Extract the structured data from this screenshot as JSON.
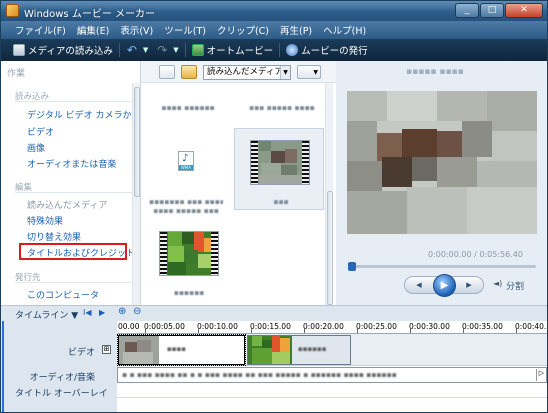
{
  "window": {
    "title": "Windows ムービー メーカー",
    "controls": [
      "_",
      "□",
      "✕"
    ]
  },
  "menu": [
    "ファイル(F)",
    "編集(E)",
    "表示(V)",
    "ツール(T)",
    "クリップ(C)",
    "再生(P)",
    "ヘルプ(H)"
  ],
  "toolbar": {
    "import_label": "メディアの読み込み",
    "undo_icon": "undo-icon",
    "redo_icon": "redo-icon",
    "automovie_label": "オートムービー",
    "publish_label": "ムービーの発行"
  },
  "tasks": {
    "pane_title": "作業",
    "import_header": "読み込み",
    "import_links": [
      "デジタル ビデオ カメラから",
      "ビデオ",
      "画像",
      "オーディオまたは音楽"
    ],
    "edit_header": "編集",
    "edit_links": [
      {
        "label": "読み込んだメディア",
        "enabled": false
      },
      {
        "label": "特殊効果",
        "enabled": true
      },
      {
        "label": "切り替え効果",
        "enabled": true
      },
      {
        "label": "タイトルおよびクレジット",
        "enabled": true,
        "highlighted": true
      }
    ],
    "publish_header": "発行先",
    "publish_links": [
      "このコンピュータ"
    ]
  },
  "collection": {
    "dropdown_label": "読み込んだメディア",
    "dropdown_arrow": "▼",
    "view_arrow": "▼",
    "wma_label": "WMA"
  },
  "monitor": {
    "timecode": "0:00:00.00 / 0:05:56.40",
    "split_label": "分割",
    "rewind": "◀",
    "play": "▶",
    "forward": "▶"
  },
  "timeline": {
    "label": "タイムライン",
    "zoom_in_icon": "⊕",
    "zoom_out_icon": "⊖",
    "ticks": [
      "00.00",
      "0:00:05.00",
      "0:00:10.00",
      "0:00:15.00",
      "0:00:20.00",
      "0:00:25.00",
      "0:00:30.00",
      "0:00:35.00",
      "0:00:40."
    ],
    "tracks": {
      "video": "ビデオ",
      "expand": "⊞",
      "audio": "オーディオ/音楽",
      "overlay": "タイトル オーバーレイ"
    }
  },
  "colors": {
    "highlight": "#e01a1a",
    "link": "#1a5fb4",
    "titlebar": "#2e5f8c"
  }
}
